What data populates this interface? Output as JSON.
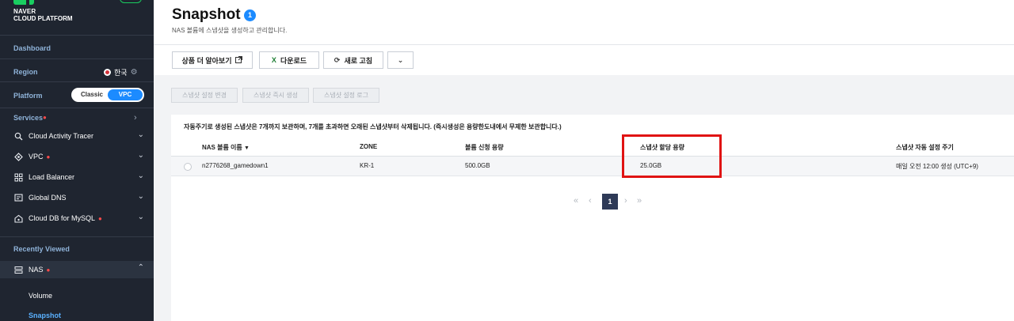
{
  "brand": {
    "line1": "NAVER",
    "line2": "CLOUD PLATFORM"
  },
  "sidebar": {
    "dashboard": "Dashboard",
    "region_label": "Region",
    "region_value": "한국",
    "platform_label": "Platform",
    "platform_options": {
      "classic": "Classic",
      "vpc": "VPC",
      "selected": "VPC"
    },
    "services_label": "Services",
    "menu": [
      {
        "label": "Cloud Activity Tracer",
        "icon": "activity-tracer-icon"
      },
      {
        "label": "VPC",
        "icon": "vpc-icon",
        "badge": "*"
      },
      {
        "label": "Load Balancer",
        "icon": "load-balancer-icon"
      },
      {
        "label": "Global DNS",
        "icon": "dns-icon"
      },
      {
        "label": "Cloud DB for MySQL",
        "icon": "database-icon",
        "badge": "*"
      }
    ],
    "recently_viewed": "Recently Viewed",
    "nas": {
      "label": "NAS",
      "badge": "*",
      "icon": "nas-icon"
    },
    "nas_sub": [
      "Volume",
      "Snapshot"
    ],
    "active_sub": "Snapshot"
  },
  "page": {
    "title": "Snapshot",
    "count": "1",
    "subtitle": "NAS 볼륨에 스냅샷을 생성하고 관리합니다."
  },
  "toolbar": {
    "learn_more": "상품 더 알아보기",
    "download": "다운로드",
    "refresh": "새로 고침"
  },
  "actions": [
    "스냅샷 설정 변경",
    "스냅샷 즉시 생성",
    "스냅샷 설정 로그"
  ],
  "notice": "자동주기로 생성된 스냅샷은 7개까지 보관하며, 7개를 초과하면 오래된 스냅샷부터 삭제됩니다. (즉시생성은 용량한도내에서 무제한 보관합니다.)",
  "table": {
    "columns": [
      "NAS 볼륨 이름",
      "ZONE",
      "볼륨 신청 용량",
      "스냅샷 할당 용량",
      "스냅샷 자동 설정 주기"
    ],
    "rows": [
      [
        "n2776268_gamedown1",
        "KR-1",
        "500.0GB",
        "25.0GB",
        "매일 오전 12:00 생성 (UTC+9)"
      ]
    ]
  },
  "pagination": {
    "current": "1"
  },
  "colors": {
    "accent": "#1c8bff",
    "sidebar_bg": "#1f2530",
    "highlight": "#e01313",
    "brand_green": "#19ce60"
  }
}
